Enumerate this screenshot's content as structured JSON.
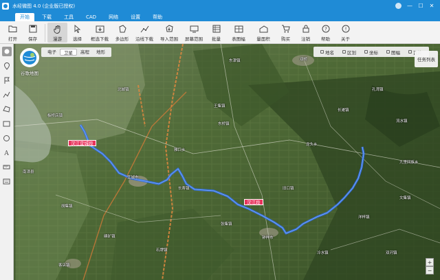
{
  "window": {
    "title": "水经微图 4.0 (企业版已授权)",
    "controls": [
      "—",
      "☐",
      "✕"
    ]
  },
  "menu": {
    "items": [
      "开始",
      "下载",
      "工具",
      "CAD",
      "网络",
      "设置",
      "帮助"
    ],
    "active_index": 0
  },
  "toolbar": {
    "items": [
      {
        "label": "打开",
        "icon": "folder-open-icon"
      },
      {
        "label": "保存",
        "icon": "save-icon"
      },
      {
        "label": "漫游",
        "icon": "hand-icon",
        "active": true
      },
      {
        "label": "选择",
        "icon": "pointer-icon"
      },
      {
        "label": "框选下载",
        "icon": "frame-download-icon"
      },
      {
        "label": "多边形",
        "icon": "polygon-icon"
      },
      {
        "label": "沿线下载",
        "icon": "line-download-icon"
      },
      {
        "label": "导入范围",
        "icon": "import-range-icon"
      },
      {
        "label": "屏幕范围",
        "icon": "screen-range-icon"
      },
      {
        "label": "批量",
        "icon": "batch-icon"
      },
      {
        "label": "表图幅",
        "icon": "sheet-icon"
      },
      {
        "label": "量面积",
        "icon": "measure-area-icon"
      },
      {
        "label": "购买",
        "icon": "cart-icon"
      },
      {
        "label": "注销",
        "icon": "lock-icon"
      },
      {
        "label": "帮助",
        "icon": "help-icon"
      },
      {
        "label": "关于",
        "icon": "info-icon"
      }
    ]
  },
  "map": {
    "logo_text": "谷歌地图",
    "types": [
      "电子",
      "卫星",
      "高程",
      "地形"
    ],
    "active_type_index": 1,
    "tools": [
      "地名",
      "区划",
      "坐标",
      "图幅",
      "瓦片"
    ],
    "task_list": "任务列表",
    "river_labels": [
      "汉江宜城段",
      "汉江段"
    ],
    "towns": [
      "北城镇",
      "王集镇",
      "东桥镇",
      "双桥",
      "孔湾镇",
      "流水镇",
      "板桥店镇",
      "雅口乡",
      "龙头乡",
      "南漳县",
      "宜城市",
      "长寿镇",
      "钟祥市",
      "九里回族乡",
      "旧口镇",
      "胡集镇",
      "磷矿镇",
      "石牌镇",
      "长滩镇",
      "客店镇",
      "张集镇",
      "洋梓镇",
      "东津镇",
      "冷水镇",
      "双河镇",
      "文集镇"
    ]
  },
  "colors": {
    "titlebar": "#1f8bd6",
    "route": "#2f6fe8",
    "label": "#e8325b"
  }
}
